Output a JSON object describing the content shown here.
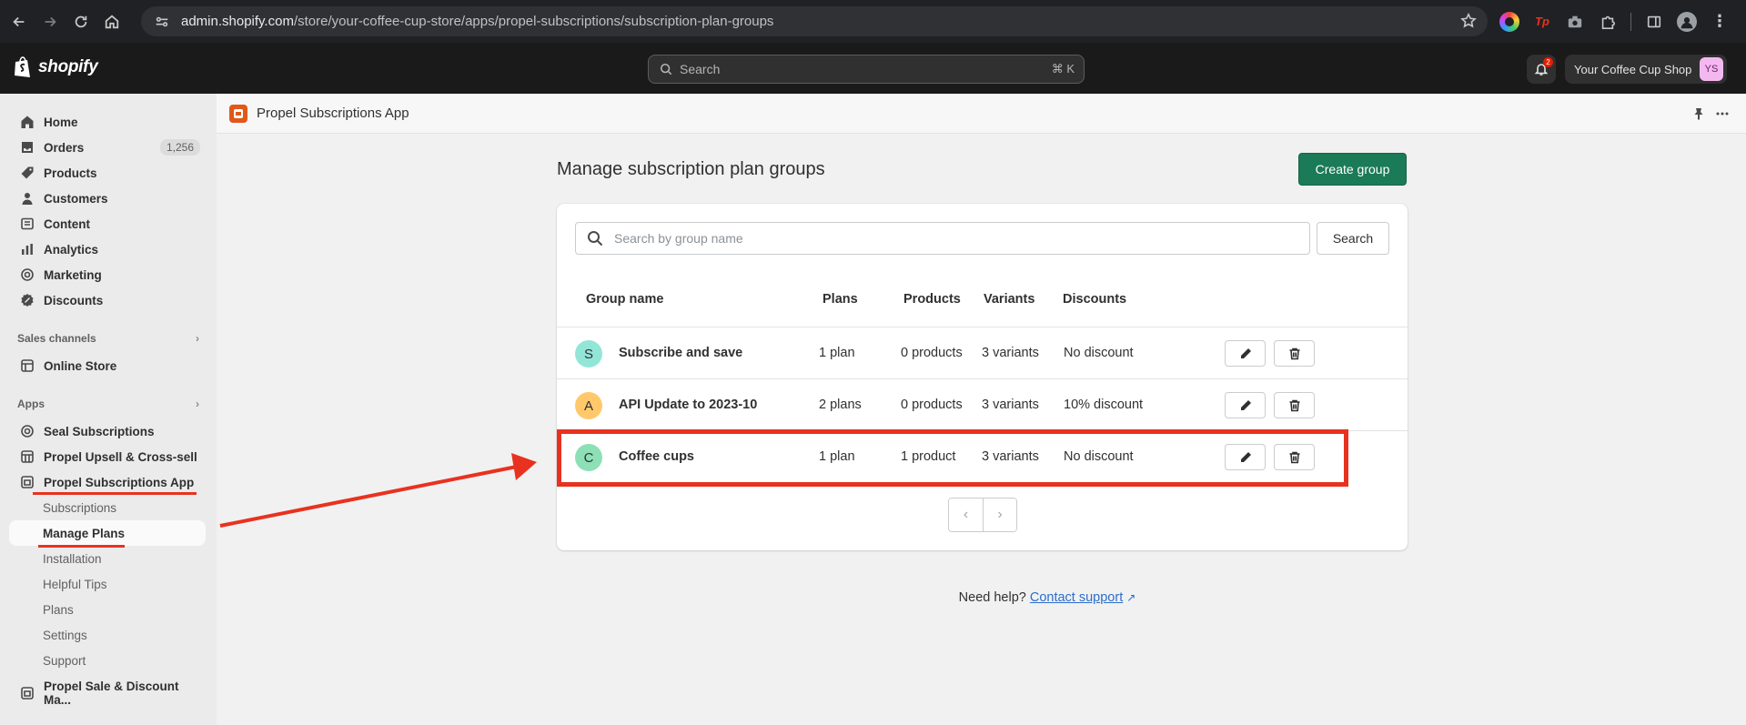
{
  "browser": {
    "url_host": "admin.shopify.com",
    "url_path": "/store/your-coffee-cup-store/apps/propel-subscriptions/subscription-plan-groups"
  },
  "topbar": {
    "logo_text": "shopify",
    "search_placeholder": "Search",
    "search_shortcut": "⌘ K",
    "notification_count": "2",
    "store_name": "Your Coffee Cup Shop",
    "store_initials": "YS"
  },
  "sidebar": {
    "items": [
      {
        "label": "Home",
        "icon": "home-icon"
      },
      {
        "label": "Orders",
        "icon": "orders-icon",
        "count": "1,256"
      },
      {
        "label": "Products",
        "icon": "tag-icon"
      },
      {
        "label": "Customers",
        "icon": "person-icon"
      },
      {
        "label": "Content",
        "icon": "content-icon"
      },
      {
        "label": "Analytics",
        "icon": "chart-icon"
      },
      {
        "label": "Marketing",
        "icon": "target-icon"
      },
      {
        "label": "Discounts",
        "icon": "discount-icon"
      }
    ],
    "sales_channels_heading": "Sales channels",
    "online_store": "Online Store",
    "apps_heading": "Apps",
    "apps": [
      {
        "label": "Seal Subscriptions"
      },
      {
        "label": "Propel Upsell & Cross-sell"
      },
      {
        "label": "Propel Subscriptions App"
      }
    ],
    "sub_items": [
      {
        "label": "Subscriptions"
      },
      {
        "label": "Manage Plans"
      },
      {
        "label": "Installation"
      },
      {
        "label": "Helpful Tips"
      },
      {
        "label": "Plans"
      },
      {
        "label": "Settings"
      },
      {
        "label": "Support"
      }
    ],
    "last_app": "Propel Sale & Discount Ma..."
  },
  "app_header": {
    "title": "Propel Subscriptions App"
  },
  "main": {
    "page_title": "Manage subscription plan groups",
    "create_button": "Create group",
    "search_placeholder": "Search by group name",
    "search_button": "Search",
    "columns": [
      "Group name",
      "Plans",
      "Products",
      "Variants",
      "Discounts"
    ],
    "rows": [
      {
        "initial": "S",
        "avatar_color": "#92e6d8",
        "name": "Subscribe and save",
        "plans": "1 plan",
        "products": "0 products",
        "variants": "3 variants",
        "discount": "No discount"
      },
      {
        "initial": "A",
        "avatar_color": "#ffc96b",
        "name": "API Update to 2023-10",
        "plans": "2 plans",
        "products": "0 products",
        "variants": "3 variants",
        "discount": "10% discount"
      },
      {
        "initial": "C",
        "avatar_color": "#8de0b6",
        "name": "Coffee cups",
        "plans": "1 plan",
        "products": "1 product",
        "variants": "3 variants",
        "discount": "No discount"
      }
    ],
    "help_text": "Need help?",
    "help_link": "Contact support"
  },
  "annotation_color": "#e8321f"
}
